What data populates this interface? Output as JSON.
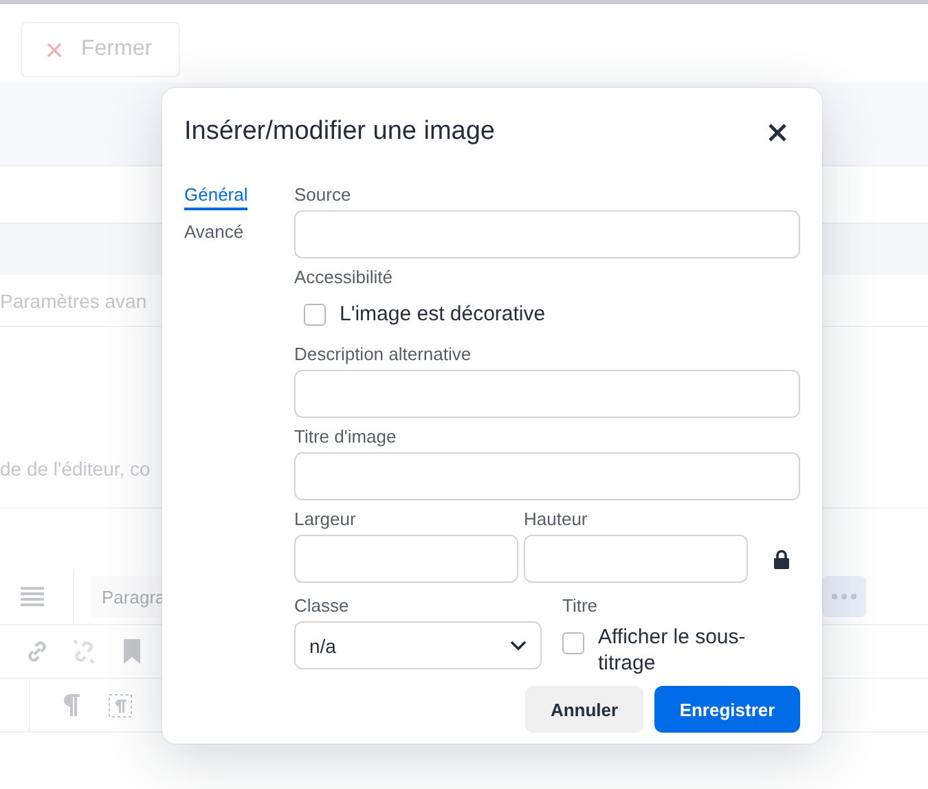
{
  "background": {
    "close_button": {
      "label": "Fermer"
    },
    "advanced_text": "Paramètres avan",
    "editor_text": "de de l'éditeur, co",
    "format_select": {
      "value": "Paragra"
    }
  },
  "dialog": {
    "title": "Insérer/modifier une image",
    "tabs": [
      {
        "label": "Général",
        "selected": true
      },
      {
        "label": "Avancé",
        "selected": false
      }
    ],
    "source": {
      "label": "Source"
    },
    "accessibility": {
      "label": "Accessibilité",
      "checkbox": {
        "label": "L'image est décorative",
        "checked": false
      }
    },
    "alt_text": {
      "label": "Description alternative"
    },
    "image_title": {
      "label": "Titre d'image"
    },
    "width": {
      "label": "Largeur"
    },
    "height": {
      "label": "Hauteur"
    },
    "locked": true,
    "class_select": {
      "label": "Classe",
      "value": "n/a"
    },
    "caption": {
      "label": "Titre",
      "checkbox": {
        "label": "Afficher le sous-titrage",
        "checked": false
      }
    },
    "buttons": [
      {
        "label": "Annuler",
        "kind": "secondary"
      },
      {
        "label": "Enregistrer",
        "kind": "primary"
      }
    ]
  }
}
